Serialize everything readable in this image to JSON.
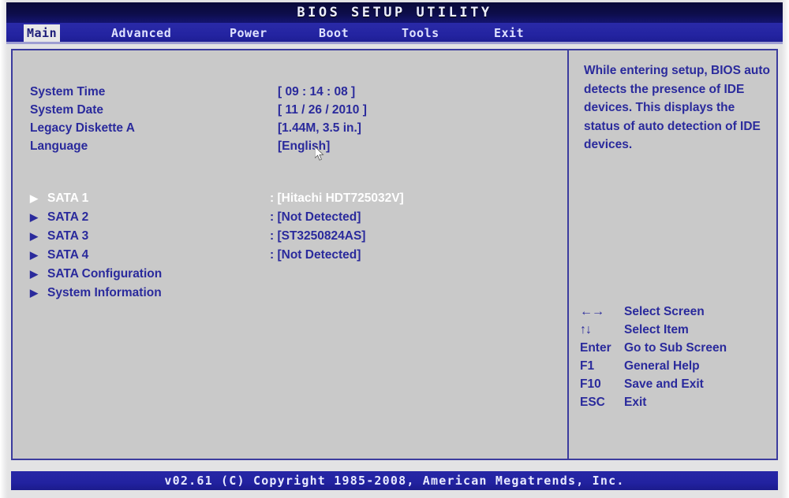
{
  "title": "BIOS SETUP UTILITY",
  "menu": {
    "items": [
      {
        "label": "Main",
        "active": true
      },
      {
        "label": "Advanced",
        "active": false
      },
      {
        "label": "Power",
        "active": false
      },
      {
        "label": "Boot",
        "active": false
      },
      {
        "label": "Tools",
        "active": false
      },
      {
        "label": "Exit",
        "active": false
      }
    ]
  },
  "main": {
    "settings": [
      {
        "label": "System Time",
        "value": "[ 09 : 14 : 08 ]"
      },
      {
        "label": "System Date",
        "value": "[ 11 / 26 / 2010 ]"
      },
      {
        "label": "Legacy Diskette A",
        "value": "[1.44M, 3.5 in.]"
      },
      {
        "label": "Language",
        "value": "[English]"
      }
    ],
    "submenus": [
      {
        "arrow": "▶",
        "label": "SATA 1",
        "value": ": [Hitachi HDT725032V]",
        "selected": true
      },
      {
        "arrow": "▶",
        "label": "SATA 2",
        "value": ": [Not Detected]",
        "selected": false
      },
      {
        "arrow": "▶",
        "label": "SATA 3",
        "value": ": [ST3250824AS]",
        "selected": false
      },
      {
        "arrow": "▶",
        "label": "SATA 4",
        "value": ": [Not Detected]",
        "selected": false
      },
      {
        "arrow": "▶",
        "label": "SATA Configuration",
        "value": "",
        "selected": false
      },
      {
        "arrow": "▶",
        "label": "System Information",
        "value": "",
        "selected": false
      }
    ]
  },
  "help": {
    "text": "While entering setup, BIOS auto detects the presence of IDE devices. This displays the status of auto detection of IDE devices."
  },
  "legend": {
    "rows": [
      {
        "key": "←→",
        "desc": "Select Screen",
        "glyph": true
      },
      {
        "key": "↑↓",
        "desc": "Select Item",
        "glyph": true
      },
      {
        "key": "Enter",
        "desc": "Go to Sub Screen",
        "glyph": false
      },
      {
        "key": "F1",
        "desc": "General Help",
        "glyph": false
      },
      {
        "key": "F10",
        "desc": "Save and Exit",
        "glyph": false
      },
      {
        "key": "ESC",
        "desc": "Exit",
        "glyph": false
      }
    ]
  },
  "footer": {
    "text": "v02.61 (C) Copyright 1985-2008, American Megatrends, Inc."
  },
  "colors": {
    "text_blue": "#2a2a9c",
    "panel_bg": "#c9c9c9",
    "bar_blue": "#2222a0",
    "title_navy": "#0d0d4a",
    "selected_text": "#ffffff"
  }
}
